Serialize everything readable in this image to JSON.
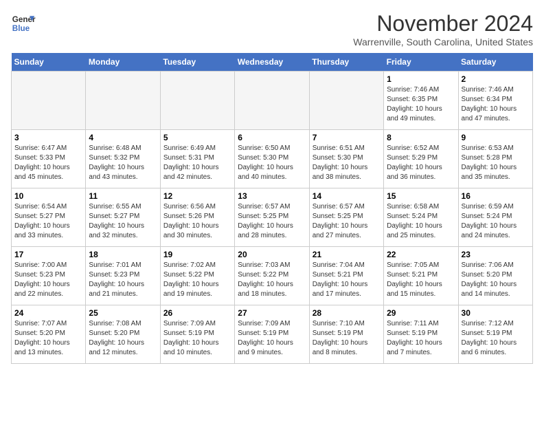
{
  "header": {
    "logo_line1": "General",
    "logo_line2": "Blue",
    "month": "November 2024",
    "location": "Warrenville, South Carolina, United States"
  },
  "weekdays": [
    "Sunday",
    "Monday",
    "Tuesday",
    "Wednesday",
    "Thursday",
    "Friday",
    "Saturday"
  ],
  "weeks": [
    [
      {
        "day": "",
        "info": ""
      },
      {
        "day": "",
        "info": ""
      },
      {
        "day": "",
        "info": ""
      },
      {
        "day": "",
        "info": ""
      },
      {
        "day": "",
        "info": ""
      },
      {
        "day": "1",
        "info": "Sunrise: 7:46 AM\nSunset: 6:35 PM\nDaylight: 10 hours\nand 49 minutes."
      },
      {
        "day": "2",
        "info": "Sunrise: 7:46 AM\nSunset: 6:34 PM\nDaylight: 10 hours\nand 47 minutes."
      }
    ],
    [
      {
        "day": "3",
        "info": "Sunrise: 6:47 AM\nSunset: 5:33 PM\nDaylight: 10 hours\nand 45 minutes."
      },
      {
        "day": "4",
        "info": "Sunrise: 6:48 AM\nSunset: 5:32 PM\nDaylight: 10 hours\nand 43 minutes."
      },
      {
        "day": "5",
        "info": "Sunrise: 6:49 AM\nSunset: 5:31 PM\nDaylight: 10 hours\nand 42 minutes."
      },
      {
        "day": "6",
        "info": "Sunrise: 6:50 AM\nSunset: 5:30 PM\nDaylight: 10 hours\nand 40 minutes."
      },
      {
        "day": "7",
        "info": "Sunrise: 6:51 AM\nSunset: 5:30 PM\nDaylight: 10 hours\nand 38 minutes."
      },
      {
        "day": "8",
        "info": "Sunrise: 6:52 AM\nSunset: 5:29 PM\nDaylight: 10 hours\nand 36 minutes."
      },
      {
        "day": "9",
        "info": "Sunrise: 6:53 AM\nSunset: 5:28 PM\nDaylight: 10 hours\nand 35 minutes."
      }
    ],
    [
      {
        "day": "10",
        "info": "Sunrise: 6:54 AM\nSunset: 5:27 PM\nDaylight: 10 hours\nand 33 minutes."
      },
      {
        "day": "11",
        "info": "Sunrise: 6:55 AM\nSunset: 5:27 PM\nDaylight: 10 hours\nand 32 minutes."
      },
      {
        "day": "12",
        "info": "Sunrise: 6:56 AM\nSunset: 5:26 PM\nDaylight: 10 hours\nand 30 minutes."
      },
      {
        "day": "13",
        "info": "Sunrise: 6:57 AM\nSunset: 5:25 PM\nDaylight: 10 hours\nand 28 minutes."
      },
      {
        "day": "14",
        "info": "Sunrise: 6:57 AM\nSunset: 5:25 PM\nDaylight: 10 hours\nand 27 minutes."
      },
      {
        "day": "15",
        "info": "Sunrise: 6:58 AM\nSunset: 5:24 PM\nDaylight: 10 hours\nand 25 minutes."
      },
      {
        "day": "16",
        "info": "Sunrise: 6:59 AM\nSunset: 5:24 PM\nDaylight: 10 hours\nand 24 minutes."
      }
    ],
    [
      {
        "day": "17",
        "info": "Sunrise: 7:00 AM\nSunset: 5:23 PM\nDaylight: 10 hours\nand 22 minutes."
      },
      {
        "day": "18",
        "info": "Sunrise: 7:01 AM\nSunset: 5:23 PM\nDaylight: 10 hours\nand 21 minutes."
      },
      {
        "day": "19",
        "info": "Sunrise: 7:02 AM\nSunset: 5:22 PM\nDaylight: 10 hours\nand 19 minutes."
      },
      {
        "day": "20",
        "info": "Sunrise: 7:03 AM\nSunset: 5:22 PM\nDaylight: 10 hours\nand 18 minutes."
      },
      {
        "day": "21",
        "info": "Sunrise: 7:04 AM\nSunset: 5:21 PM\nDaylight: 10 hours\nand 17 minutes."
      },
      {
        "day": "22",
        "info": "Sunrise: 7:05 AM\nSunset: 5:21 PM\nDaylight: 10 hours\nand 15 minutes."
      },
      {
        "day": "23",
        "info": "Sunrise: 7:06 AM\nSunset: 5:20 PM\nDaylight: 10 hours\nand 14 minutes."
      }
    ],
    [
      {
        "day": "24",
        "info": "Sunrise: 7:07 AM\nSunset: 5:20 PM\nDaylight: 10 hours\nand 13 minutes."
      },
      {
        "day": "25",
        "info": "Sunrise: 7:08 AM\nSunset: 5:20 PM\nDaylight: 10 hours\nand 12 minutes."
      },
      {
        "day": "26",
        "info": "Sunrise: 7:09 AM\nSunset: 5:19 PM\nDaylight: 10 hours\nand 10 minutes."
      },
      {
        "day": "27",
        "info": "Sunrise: 7:09 AM\nSunset: 5:19 PM\nDaylight: 10 hours\nand 9 minutes."
      },
      {
        "day": "28",
        "info": "Sunrise: 7:10 AM\nSunset: 5:19 PM\nDaylight: 10 hours\nand 8 minutes."
      },
      {
        "day": "29",
        "info": "Sunrise: 7:11 AM\nSunset: 5:19 PM\nDaylight: 10 hours\nand 7 minutes."
      },
      {
        "day": "30",
        "info": "Sunrise: 7:12 AM\nSunset: 5:19 PM\nDaylight: 10 hours\nand 6 minutes."
      }
    ]
  ]
}
